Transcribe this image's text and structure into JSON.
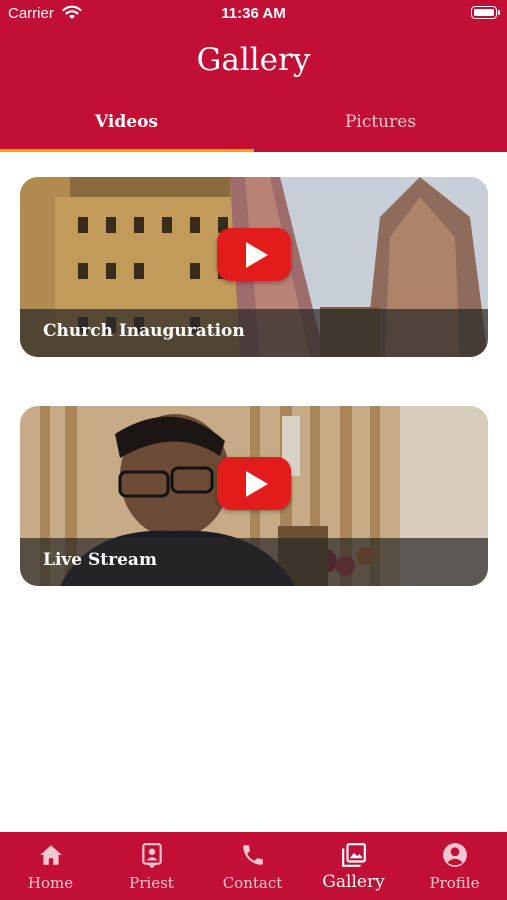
{
  "status_bar": {
    "carrier": "Carrier",
    "time": "11:36 AM"
  },
  "header": {
    "title": "Gallery"
  },
  "tabs": [
    {
      "label": "Videos",
      "active": true
    },
    {
      "label": "Pictures",
      "active": false
    }
  ],
  "videos": [
    {
      "caption": "Church Inauguration"
    },
    {
      "caption": "Live Stream"
    }
  ],
  "bottom_nav": [
    {
      "label": "Home",
      "icon": "home-icon"
    },
    {
      "label": "Priest",
      "icon": "priest-badge-icon"
    },
    {
      "label": "Contact",
      "icon": "phone-icon"
    },
    {
      "label": "Gallery",
      "icon": "gallery-icon",
      "active": true
    },
    {
      "label": "Profile",
      "icon": "profile-icon"
    }
  ],
  "colors": {
    "primary": "#c20f35",
    "tab_indicator": "#f0a500",
    "play": "#e21b1b"
  }
}
